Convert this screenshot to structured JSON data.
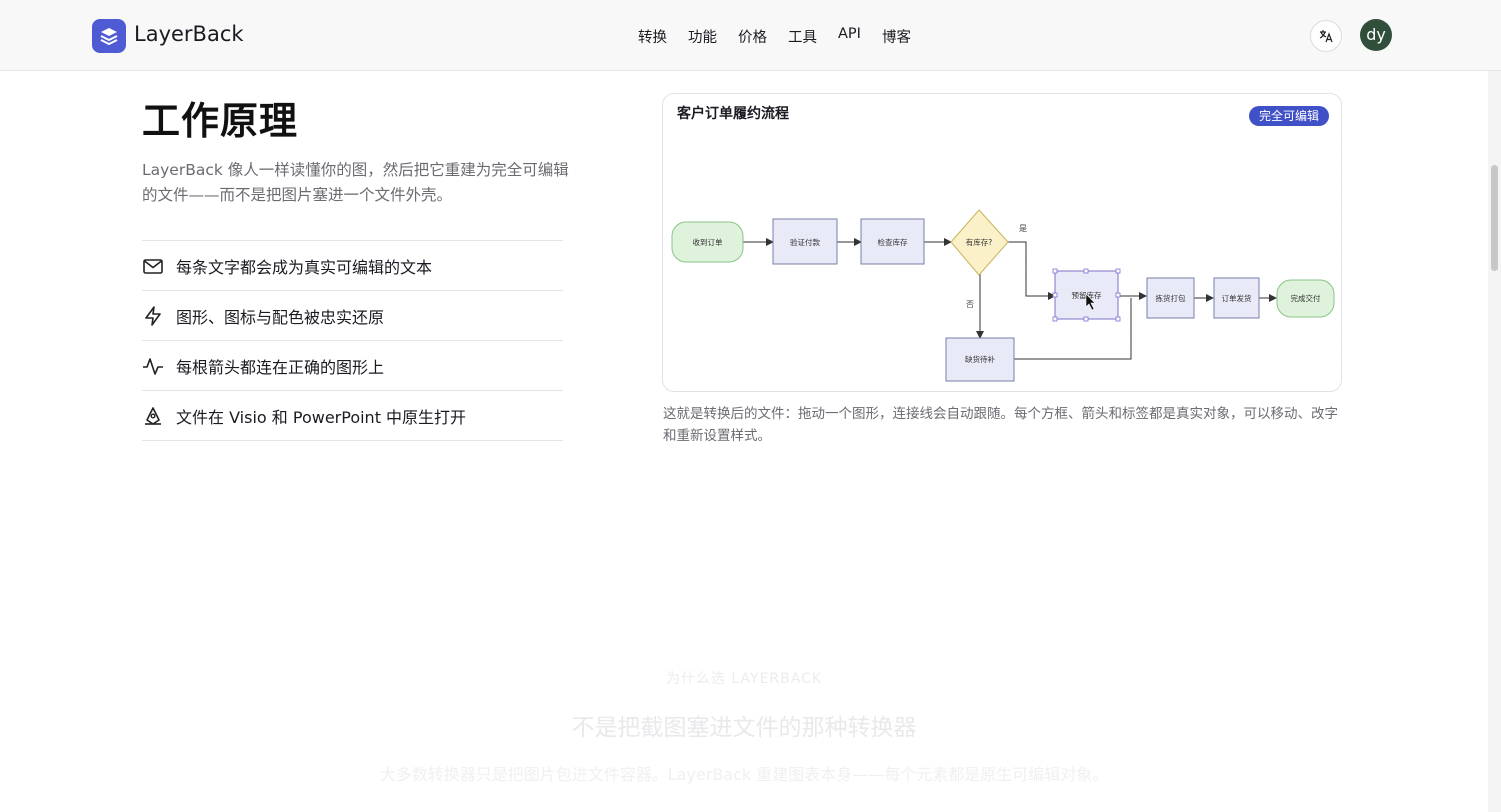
{
  "header": {
    "brand": "LayerBack",
    "nav": [
      "转换",
      "功能",
      "价格",
      "工具",
      "API",
      "博客"
    ],
    "avatar_initials": "dy"
  },
  "how": {
    "title": "工作原理",
    "lead": "LayerBack 像人一样读懂你的图，然后把它重建为完全可编辑的文件——而不是把图片塞进一个文件外壳。",
    "features": [
      {
        "icon": "mail-icon",
        "text": "每条文字都会成为真实可编辑的文本"
      },
      {
        "icon": "zap-icon",
        "text": "图形、图标与配色被忠实还原"
      },
      {
        "icon": "activity-icon",
        "text": "每根箭头都连在正确的图形上"
      },
      {
        "icon": "pen-tool-icon",
        "text": "文件在 Visio 和 PowerPoint 中原生打开"
      }
    ]
  },
  "diagram": {
    "title": "客户订单履约流程",
    "badge": "完全可编辑",
    "nodes": {
      "start": "收到订单",
      "verify": "验证付款",
      "check": "检查库存",
      "decision": "有库存?",
      "reserve": "预留库存",
      "pick": "拣货打包",
      "ship": "订单发货",
      "done": "完成交付",
      "backorder": "缺货待补"
    },
    "edge_labels": {
      "yes": "是",
      "no": "否"
    },
    "caption": "这就是转换后的文件：拖动一个图形，连接线会自动跟随。每个方框、箭头和标签都是真实对象，可以移动、改字和重新设置样式。"
  },
  "why": {
    "kicker": "为什么选 LAYERBACK",
    "title": "不是把截图塞进文件的那种转换器",
    "subtitle": "大多数转换器只是把图片包进文件容器。LayerBack 重建图表本身——每个元素都是原生可编辑对象。"
  },
  "colors": {
    "accent": "#4051c8",
    "logo": "#4f5bd5",
    "avatar": "#2f4f3b",
    "node_blue": "#e8eaf8",
    "node_green": "#dff2dc",
    "node_yellow": "#fbf1c8"
  }
}
